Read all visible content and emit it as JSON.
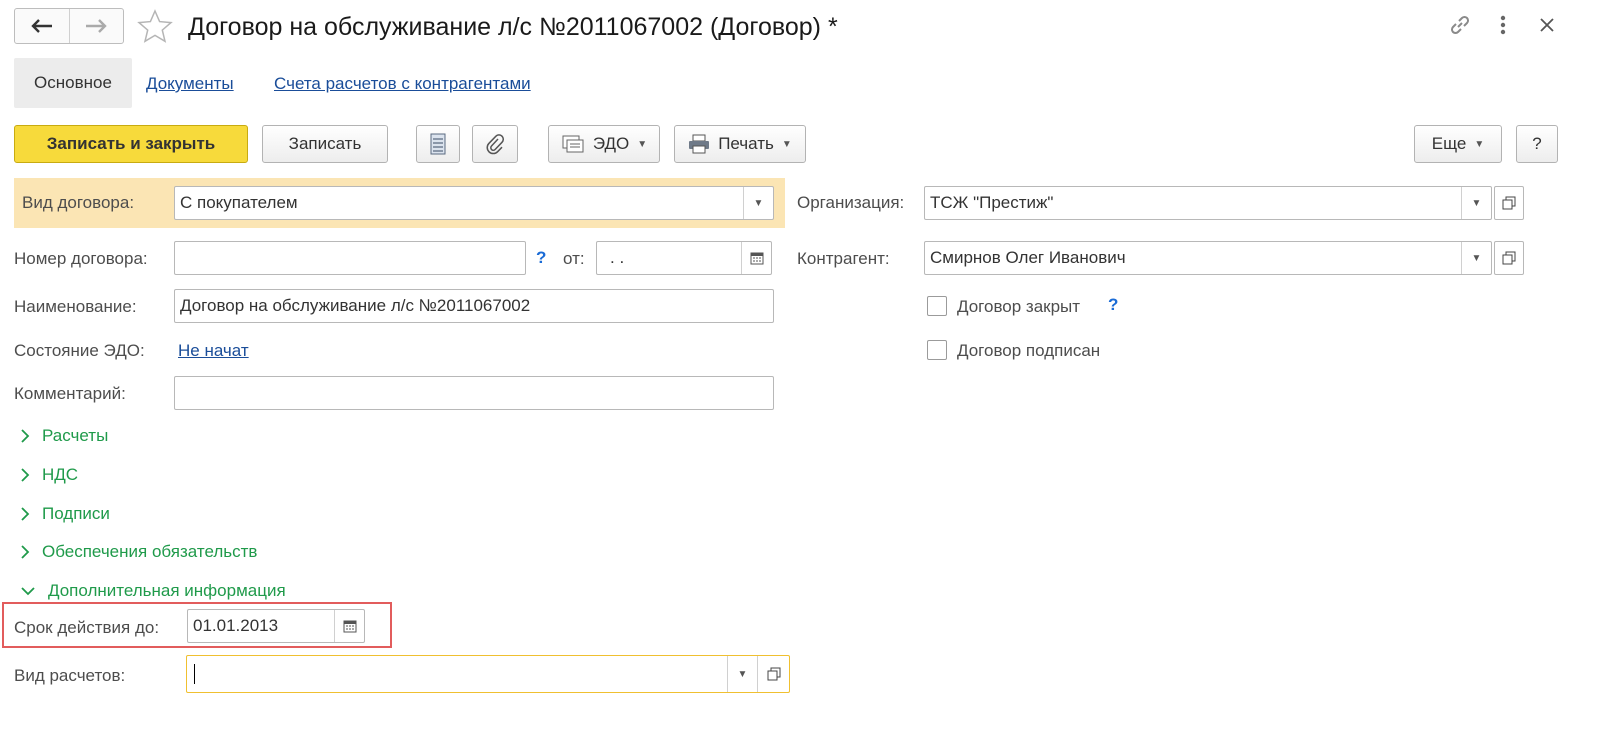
{
  "window": {
    "title": "Договор на обслуживание л/с №2011067002 (Договор) *"
  },
  "tabs": [
    {
      "label": "Основное"
    },
    {
      "label": "Документы"
    },
    {
      "label": "Счета расчетов с контрагентами"
    }
  ],
  "toolbar": {
    "save_close_label": "Записать и закрыть",
    "save_label": "Записать",
    "edo_label": "ЭДО",
    "print_label": "Печать",
    "more_label": "Еще",
    "help_label": "?"
  },
  "form": {
    "contract_type": {
      "label": "Вид договора:",
      "value": "С покупателем"
    },
    "contract_number": {
      "label": "Номер договора:",
      "value": "",
      "hint": "?",
      "date_label": "от:",
      "date_value": " .  ."
    },
    "name": {
      "label": "Наименование:",
      "value": "Договор на обслуживание л/с №2011067002"
    },
    "edo_state": {
      "label": "Состояние ЭДО:",
      "value": "Не начат"
    },
    "comment": {
      "label": "Комментарий:",
      "value": ""
    },
    "organization": {
      "label": "Организация:",
      "value": "ТСЖ \"Престиж\""
    },
    "counterparty": {
      "label": "Контрагент:",
      "value": "Смирнов Олег Иванович"
    },
    "contract_closed": {
      "label": "Договор закрыт",
      "hint": "?",
      "checked": false
    },
    "contract_signed": {
      "label": "Договор подписан",
      "checked": false
    },
    "valid_until": {
      "label": "Срок действия до:",
      "value": "01.01.2013"
    },
    "settlement_type": {
      "label": "Вид расчетов:",
      "value": ""
    }
  },
  "sections": [
    {
      "label": "Расчеты",
      "expanded": false
    },
    {
      "label": "НДС",
      "expanded": false
    },
    {
      "label": "Подписи",
      "expanded": false
    },
    {
      "label": "Обеспечения обязательств",
      "expanded": false
    },
    {
      "label": "Дополнительная информация",
      "expanded": true
    }
  ],
  "colors": {
    "primary_button": "#f7da3b",
    "highlight_row": "#fbe5b4",
    "section_green": "#1f9a4a",
    "link_blue": "#1a4d99",
    "focus_border": "#f0c030",
    "annotation_red": "#e25c5c"
  }
}
